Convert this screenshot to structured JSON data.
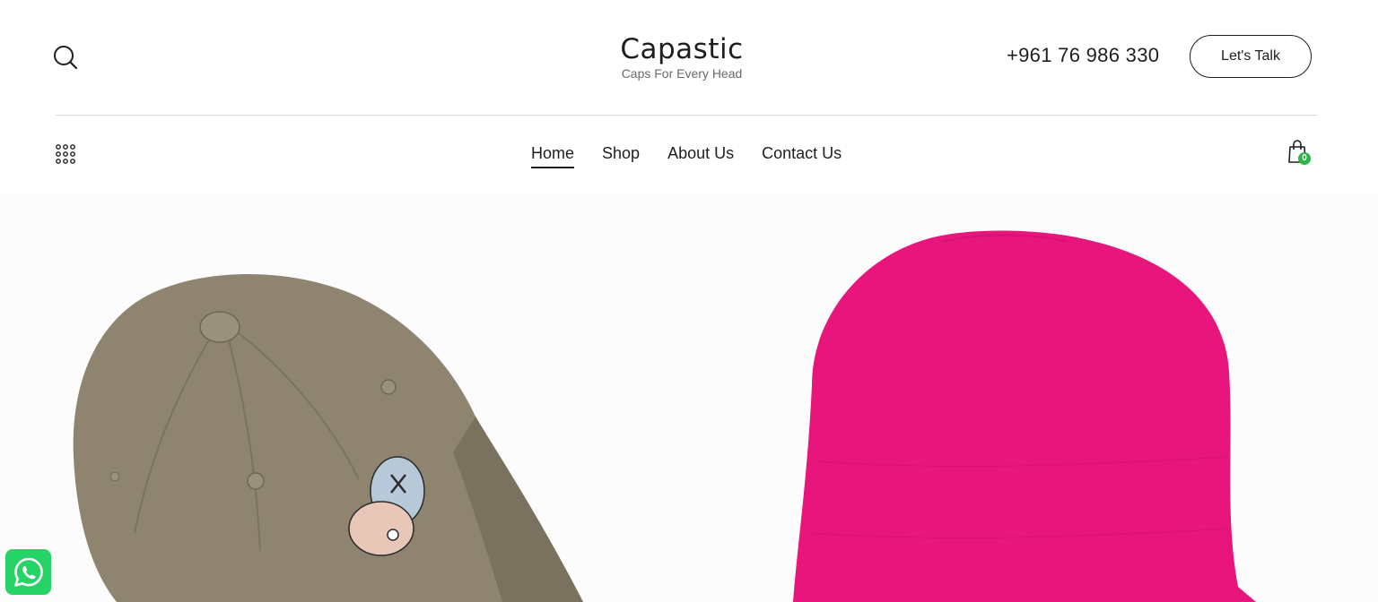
{
  "header": {
    "search_icon": "search-icon",
    "brand_name": "Capastic",
    "brand_tagline": "Caps For Every Head",
    "phone": "+961 76 986 330",
    "cta_label": "Let's Talk"
  },
  "nav": {
    "menu_icon": "grid-dots-icon",
    "items": [
      {
        "label": "Home",
        "active": true
      },
      {
        "label": "Shop"
      },
      {
        "label": "About Us"
      },
      {
        "label": "Contact Us"
      }
    ],
    "cart_icon": "shopping-bag-icon",
    "cart_count": "0"
  },
  "hero": {
    "products": [
      "khaki-cap-image",
      "pink-beanie-image"
    ]
  },
  "floating": {
    "whatsapp_icon": "whatsapp-icon"
  },
  "colors": {
    "accent_green": "#2db34a",
    "whatsapp_green": "#25d366",
    "beanie_pink": "#e8157c",
    "cap_khaki": "#8e8470"
  }
}
